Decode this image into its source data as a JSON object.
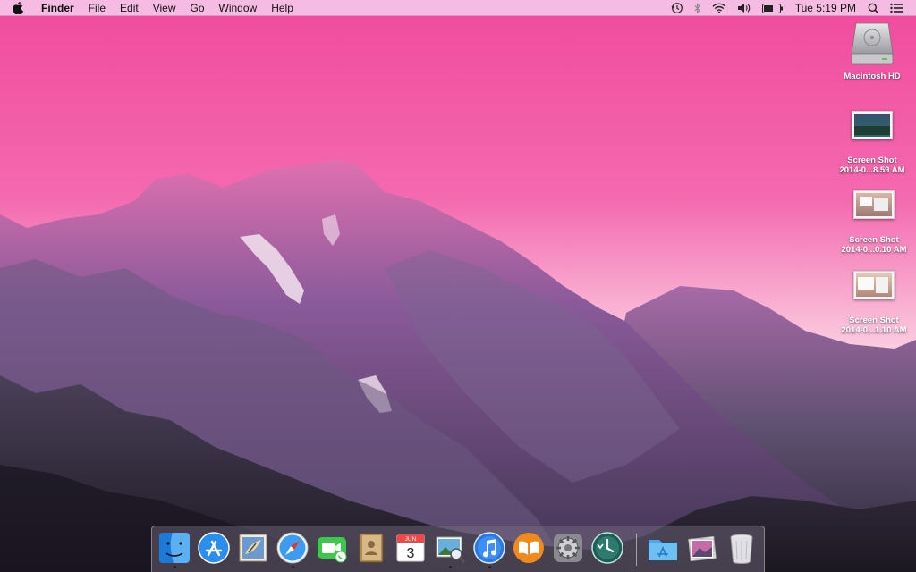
{
  "menubar": {
    "app_name": "Finder",
    "menus": [
      "File",
      "Edit",
      "View",
      "Go",
      "Window",
      "Help"
    ],
    "clock": "Tue 5:19 PM",
    "status_icons": [
      "time-machine-icon",
      "bluetooth-icon",
      "wifi-icon",
      "volume-icon",
      "battery-icon",
      "spotlight-icon",
      "notification-center-icon"
    ]
  },
  "desktop": {
    "icons": [
      {
        "label": "Macintosh HD",
        "icon": "hard-drive-icon"
      },
      {
        "label": "Screen Shot\n2014-0...8.59 AM",
        "line1": "Screen Shot",
        "line2": "2014-0...8.59 AM",
        "icon": "screenshot-icon"
      },
      {
        "label": "Screen Shot 2014-0...0.10 AM",
        "line1": "Screen Shot",
        "line2": "2014-0...0.10 AM",
        "icon": "screenshot-icon"
      },
      {
        "label": "Screen Shot 2014-0...1.10 AM",
        "line1": "Screen Shot",
        "line2": "2014-0...1.10 AM",
        "icon": "screenshot-icon"
      }
    ]
  },
  "dock": {
    "apps": [
      {
        "name": "Finder",
        "icon": "finder-icon",
        "running": true
      },
      {
        "name": "App Store",
        "icon": "app-store-icon",
        "running": false
      },
      {
        "name": "Mail",
        "icon": "mail-icon",
        "running": false
      },
      {
        "name": "Safari",
        "icon": "safari-icon",
        "running": true
      },
      {
        "name": "FaceTime",
        "icon": "facetime-icon",
        "running": false
      },
      {
        "name": "Contacts",
        "icon": "contacts-icon",
        "running": false
      },
      {
        "name": "Calendar",
        "icon": "calendar-icon",
        "running": false,
        "month": "JUN",
        "day": "3"
      },
      {
        "name": "Preview",
        "icon": "preview-icon",
        "running": true
      },
      {
        "name": "iTunes",
        "icon": "itunes-icon",
        "running": true
      },
      {
        "name": "iBooks",
        "icon": "ibooks-icon",
        "running": false
      },
      {
        "name": "System Preferences",
        "icon": "system-preferences-icon",
        "running": false
      },
      {
        "name": "Time Machine",
        "icon": "time-machine-icon",
        "running": false
      }
    ],
    "right_items": [
      {
        "name": "Applications",
        "icon": "applications-folder-icon"
      },
      {
        "name": "Downloads",
        "icon": "downloads-stack-icon"
      },
      {
        "name": "Trash",
        "icon": "trash-icon"
      }
    ]
  },
  "colors": {
    "sky_top": "#f04a9c",
    "sky_bottom": "#fbd4e4",
    "mountain_light": "#c46aa0",
    "mountain_dark": "#2a2238"
  }
}
